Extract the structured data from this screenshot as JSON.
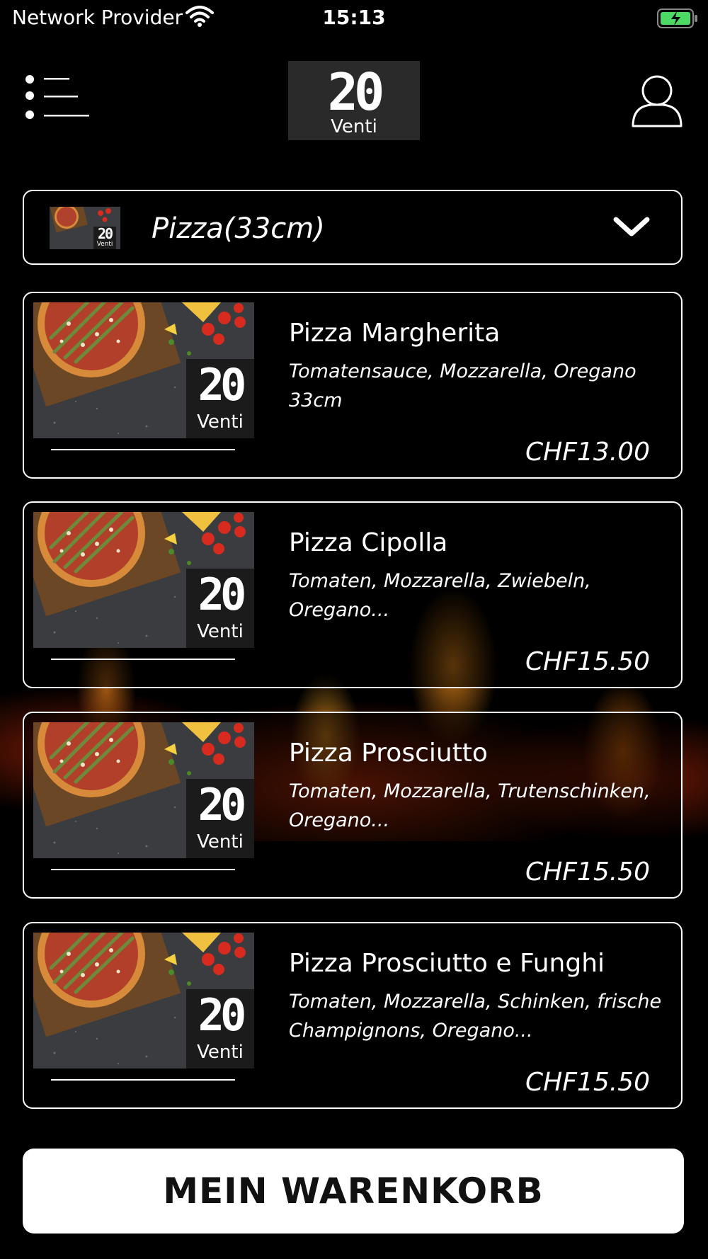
{
  "status_bar": {
    "carrier": "Network Provider",
    "time": "15:13"
  },
  "header": {
    "logo_digits": "20",
    "logo_word": "Venti",
    "menu_icon": "list-menu-icon",
    "profile_icon": "user-icon"
  },
  "category": {
    "label": "Pizza(33cm)",
    "thumb_digits": "20",
    "thumb_word": "Venti"
  },
  "products": [
    {
      "name": "Pizza Margherita",
      "description": "Tomatensauce, Mozzarella, Oregano 33cm",
      "price": "CHF13.00",
      "badge_digits": "20",
      "badge_word": "Venti"
    },
    {
      "name": "Pizza Cipolla",
      "description": "Tomaten, Mozzarella, Zwiebeln, Oregano...",
      "price": "CHF15.50",
      "badge_digits": "20",
      "badge_word": "Venti"
    },
    {
      "name": "Pizza Prosciutto",
      "description": "Tomaten, Mozzarella, Trutenschinken, Oregano...",
      "price": "CHF15.50",
      "badge_digits": "20",
      "badge_word": "Venti"
    },
    {
      "name": "Pizza Prosciutto e Funghi",
      "description": "Tomaten, Mozzarella, Schinken, frische Champignons, Oregano...",
      "price": "CHF15.50",
      "badge_digits": "20",
      "badge_word": "Venti"
    }
  ],
  "cart": {
    "label": "MEIN WARENKORB"
  },
  "colors": {
    "background": "#000000",
    "accent": "#ffffff",
    "battery_green": "#4cd964"
  }
}
